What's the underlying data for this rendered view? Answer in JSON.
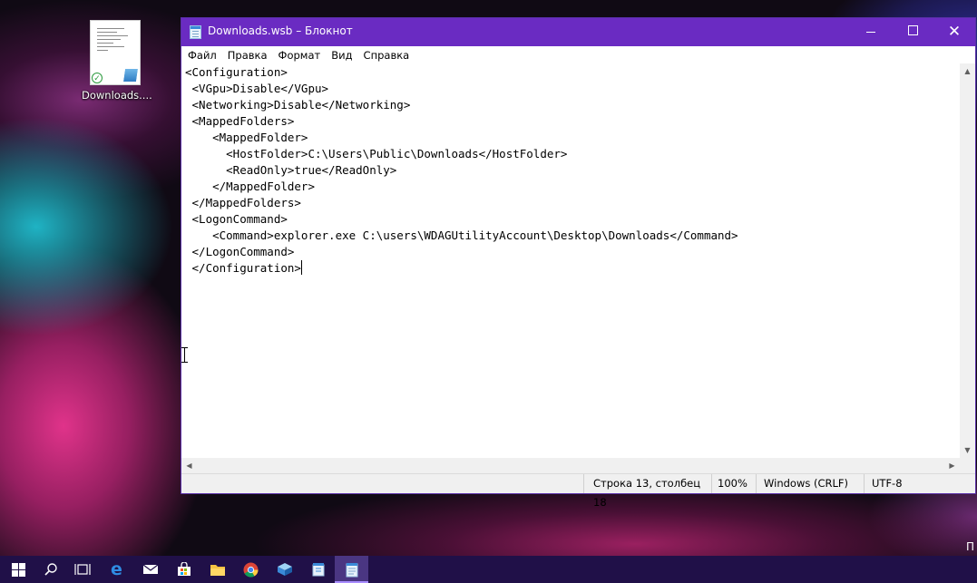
{
  "desktop": {
    "icon_label": "Downloads....",
    "corner_text": "П"
  },
  "window": {
    "title": "Downloads.wsb – Блокнот",
    "buttons": {
      "minimize": "minimize",
      "maximize": "maximize",
      "close": "✕"
    }
  },
  "menu": {
    "file": "Файл",
    "edit": "Правка",
    "format": "Формат",
    "view": "Вид",
    "help": "Справка"
  },
  "editor": {
    "lines": [
      "<Configuration>",
      " <VGpu>Disable</VGpu>",
      " <Networking>Disable</Networking>",
      " <MappedFolders>",
      "    <MappedFolder>",
      "      <HostFolder>C:\\Users\\Public\\Downloads</HostFolder>",
      "      <ReadOnly>true</ReadOnly>",
      "    </MappedFolder>",
      " </MappedFolders>",
      " <LogonCommand>",
      "    <Command>explorer.exe C:\\users\\WDAGUtilityAccount\\Desktop\\Downloads</Command>",
      " </LogonCommand>",
      " </Configuration>"
    ]
  },
  "status": {
    "position": "Строка 13, столбец 18",
    "zoom": "100%",
    "line_ending": "Windows (CRLF)",
    "encoding": "UTF-8"
  },
  "taskbar": {
    "items": [
      "windows-start",
      "search",
      "task-view",
      "edge",
      "mail",
      "store",
      "file-explorer",
      "chrome",
      "sandbox",
      "notes-app",
      "notepad"
    ]
  }
}
